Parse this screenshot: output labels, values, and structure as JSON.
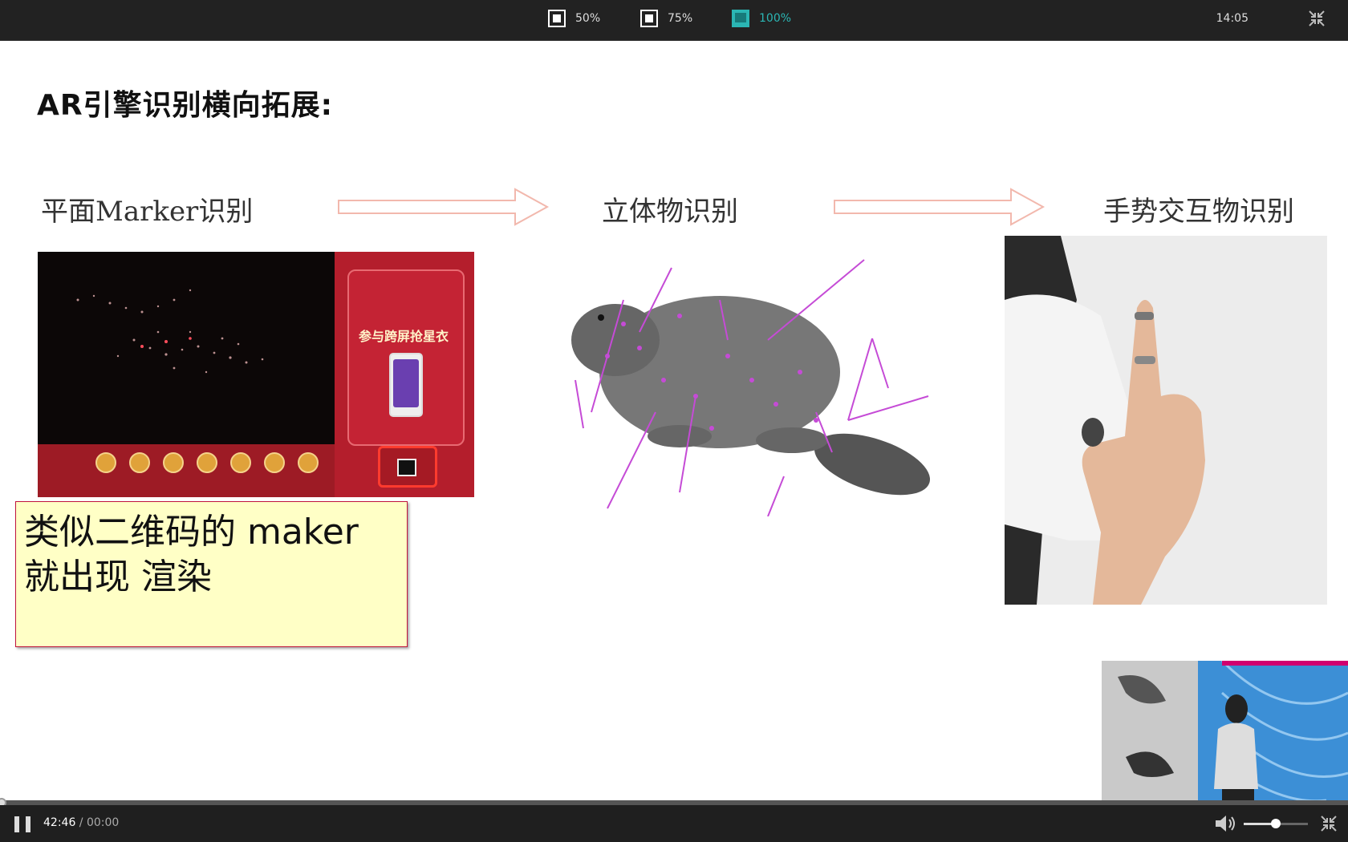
{
  "topbar": {
    "zoom_options": [
      {
        "label": "50%",
        "active": false
      },
      {
        "label": "75%",
        "active": false
      },
      {
        "label": "100%",
        "active": true
      }
    ],
    "clock": "14:05",
    "accent_color": "#2bb6b4"
  },
  "slide": {
    "title": "AR引擎识别横向拓展:",
    "stages": [
      "平面Marker识别",
      "立体物识别",
      "手势交互物识别"
    ],
    "marker_image": {
      "promo_title": "参与跨屏抢星衣"
    }
  },
  "note": {
    "line1": "类似二维码的 maker",
    "line2": "就出现 渲染"
  },
  "player": {
    "current_time": "42:46",
    "separator": " / ",
    "duration": "00:00",
    "progress": 0.0,
    "volume": 0.5
  },
  "icons": {
    "top_collapse": "collapse-icon",
    "bottom_collapse": "collapse-icon",
    "volume": "volume-icon",
    "pause": "pause-icon"
  }
}
